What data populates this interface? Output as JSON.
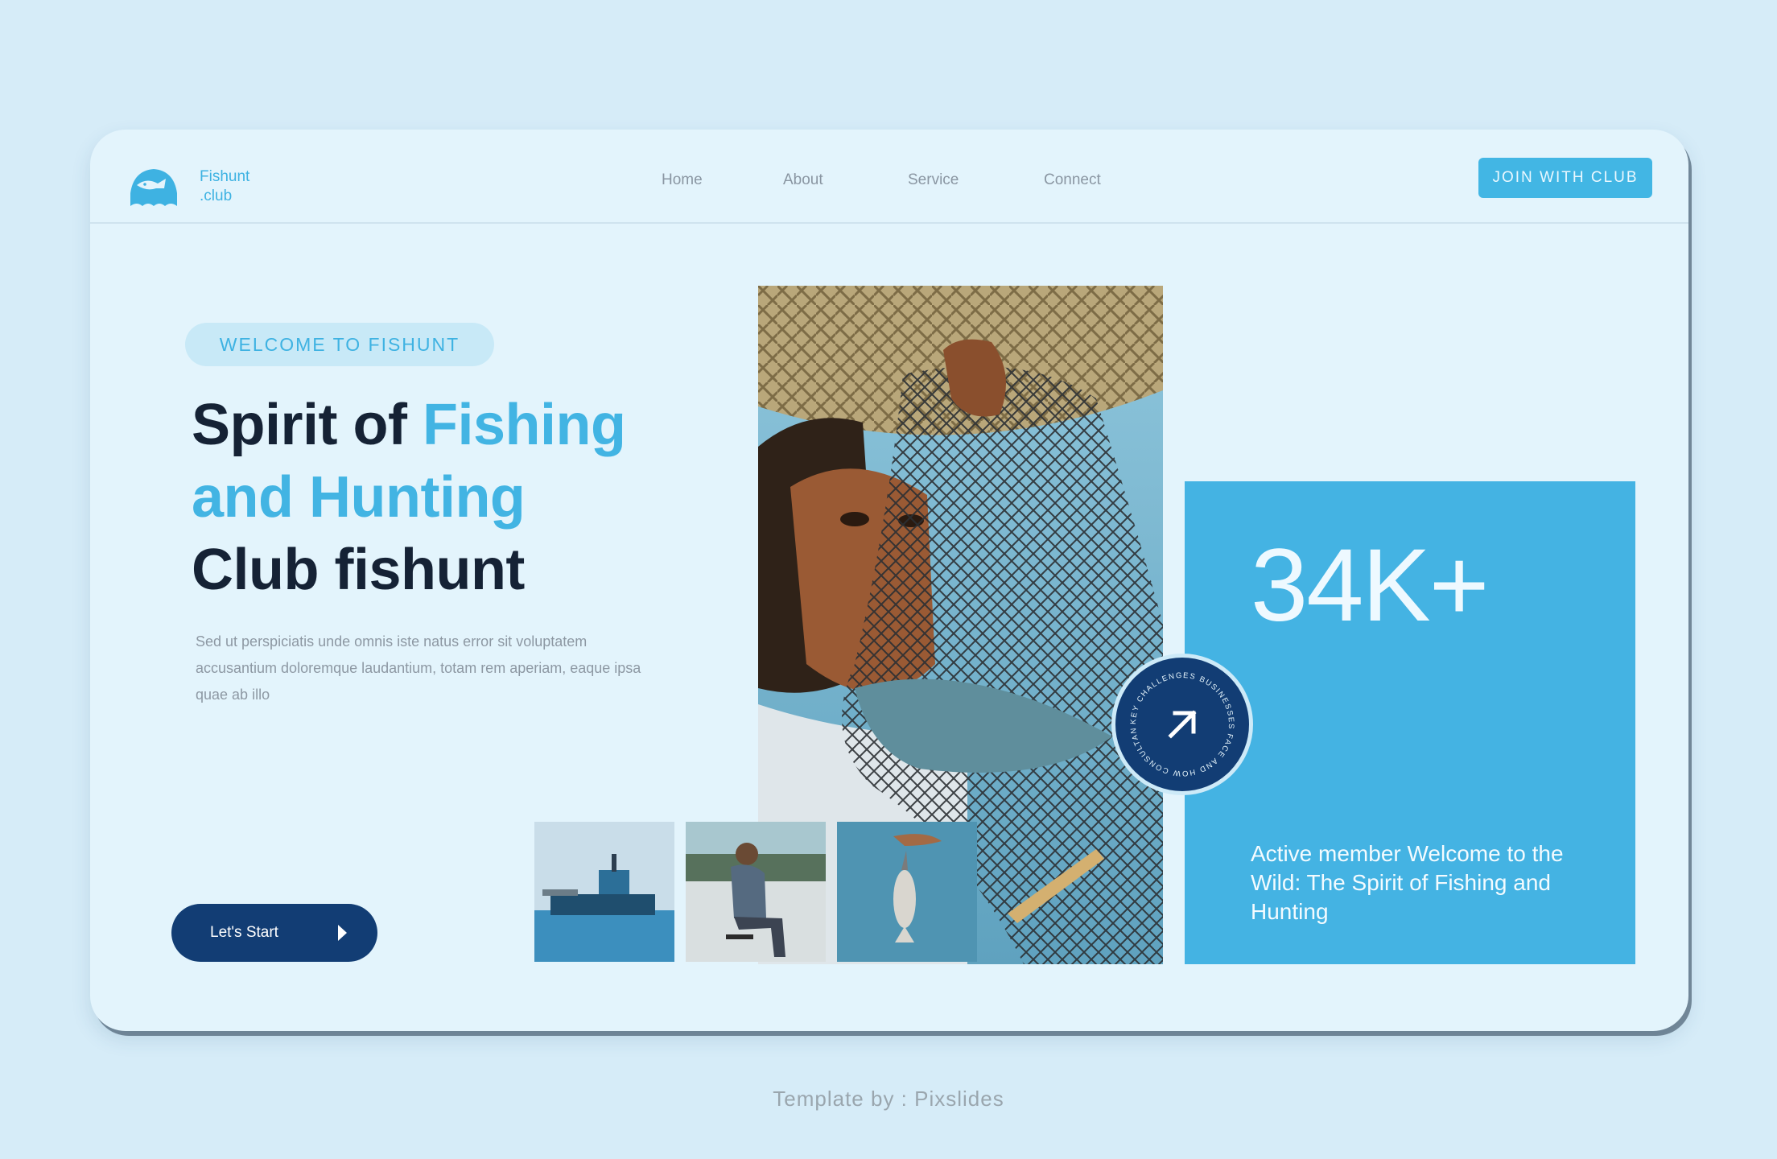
{
  "brand": {
    "line1": "Fishunt",
    "line2": ".club"
  },
  "nav": {
    "items": [
      "Home",
      "About",
      "Service",
      "Connect"
    ]
  },
  "header": {
    "join_label": "JOIN WITH CLUB"
  },
  "hero": {
    "eyebrow": "WELCOME TO FISHUNT",
    "title_part1": "Spirit of ",
    "title_accent1": "Fishing",
    "title_accent2": "and Hunting",
    "title_part3": "Club fishunt",
    "description": "Sed ut perspiciatis unde omnis iste natus error sit voluptatem accusantium doloremque laudantium, totam rem aperiam, eaque ipsa quae ab illo",
    "cta_label": "Let's Start"
  },
  "stats": {
    "value": "34K+",
    "caption": "Active member Welcome to the Wild: The Spirit of Fishing and Hunting"
  },
  "badge": {
    "ring_text": "KEY CHALLENGES BUSINESSES FACE AND HOW CONSULTANTS "
  },
  "footer": {
    "credit": "Template by : Pixslides"
  },
  "colors": {
    "page_bg": "#d6ecf8",
    "card_bg": "#e3f4fc",
    "accent": "#42b4e3",
    "navy": "#123d74",
    "heading": "#152235"
  }
}
